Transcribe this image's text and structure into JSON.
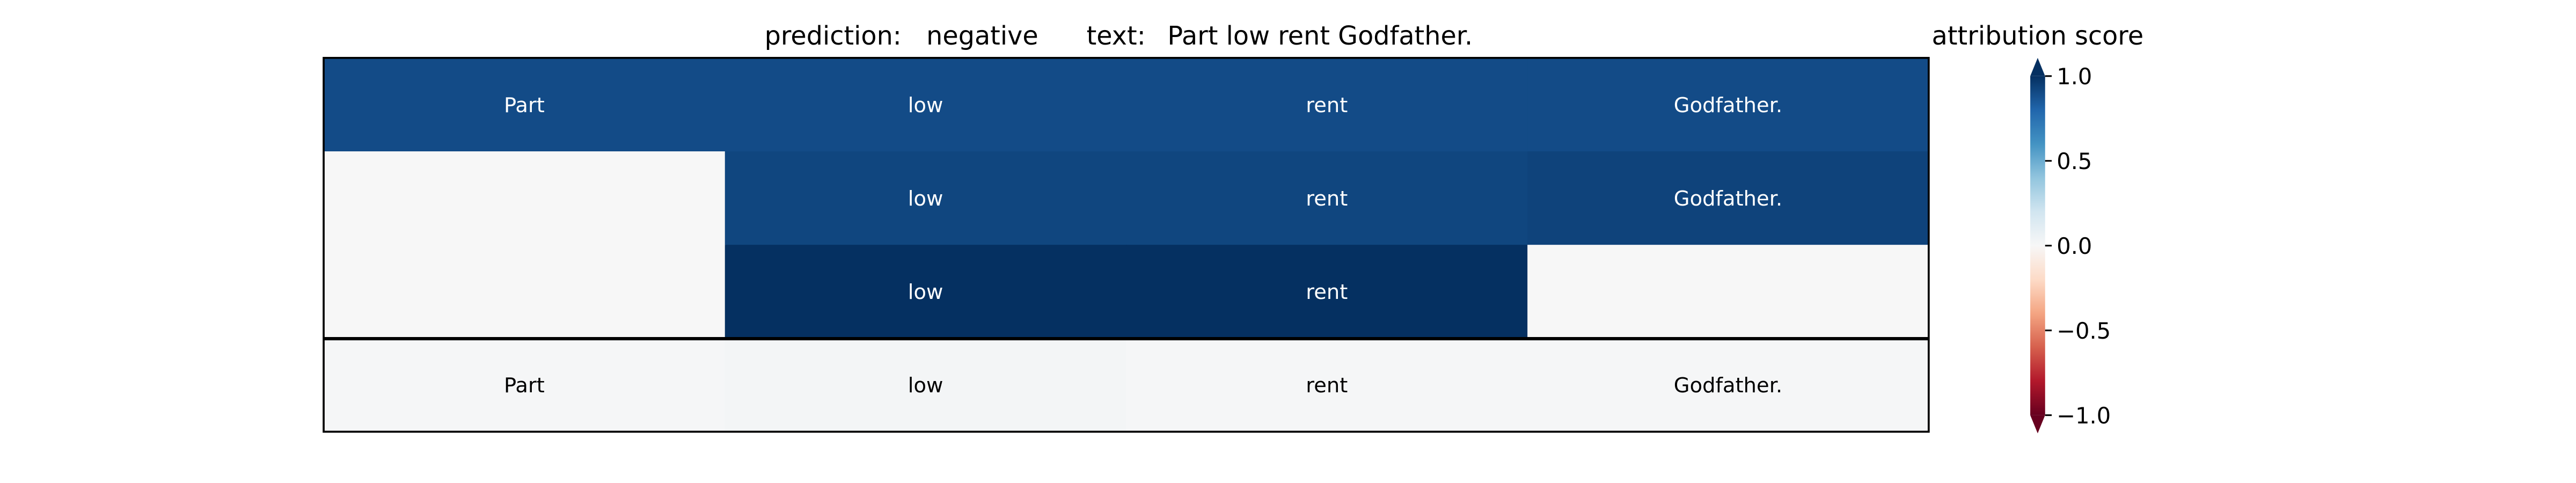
{
  "header": {
    "prediction_label": "prediction:",
    "prediction_value": "negative",
    "text_label": "text:",
    "text_value": "Part low rent Godfather."
  },
  "colorbar": {
    "title": "attribution score",
    "ticks": [
      "1.0",
      "0.5",
      "0.0",
      "−0.5",
      "−1.0"
    ],
    "tick_values": [
      1.0,
      0.5,
      0.0,
      -0.5,
      -1.0
    ],
    "range": [
      -1.0,
      1.0
    ],
    "colormap": "RdBu",
    "extend": "both"
  },
  "chart_data": {
    "type": "heatmap",
    "title": "",
    "xlabel": "",
    "ylabel": "",
    "columns": 4,
    "rows": [
      {
        "cells": [
          {
            "text": "Part",
            "value": 0.9
          },
          {
            "text": "low",
            "value": 0.9
          },
          {
            "text": "rent",
            "value": 0.9
          },
          {
            "text": "Godfather.",
            "value": 0.9
          }
        ]
      },
      {
        "cells": [
          {
            "text": "",
            "value": 0.0
          },
          {
            "text": "low",
            "value": 0.92
          },
          {
            "text": "rent",
            "value": 0.92
          },
          {
            "text": "Godfather.",
            "value": 0.93
          }
        ]
      },
      {
        "cells": [
          {
            "text": "",
            "value": 0.0
          },
          {
            "text": "low",
            "value": 1.0
          },
          {
            "text": "rent",
            "value": 1.0
          },
          {
            "text": "",
            "value": 0.0
          }
        ]
      },
      {
        "cells": [
          {
            "text": "Part",
            "value": 0.01
          },
          {
            "text": "low",
            "value": 0.02
          },
          {
            "text": "rent",
            "value": 0.01
          },
          {
            "text": "Godfather.",
            "value": 0.01
          }
        ]
      }
    ]
  }
}
